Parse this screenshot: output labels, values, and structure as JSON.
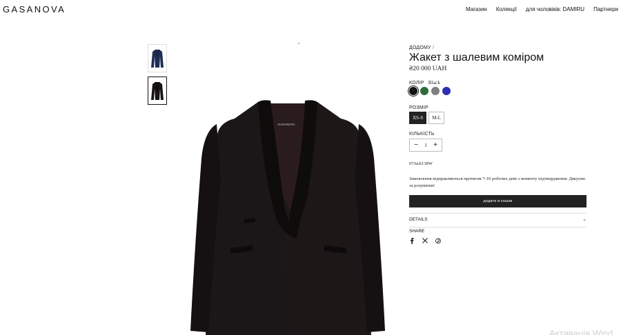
{
  "header": {
    "logo": "GASANOVA",
    "nav": [
      "Магазин",
      "Колекції",
      "для чоловіків: DAMIRU",
      "Партнери"
    ]
  },
  "breadcrumb": {
    "home": "ДОДОМУ",
    "separator": "/"
  },
  "product": {
    "title": "Жакет з шалевим коміром",
    "price": "₴20 000 UAH",
    "color_label": "КОЛІР",
    "color_value": "Black",
    "colors": [
      "#111111",
      "#2e6b3a",
      "#7f7f7f",
      "#2a2fb0"
    ],
    "size_label": "РОЗМІР",
    "sizes": [
      "XS-S",
      "M-L"
    ],
    "selected_size": "XS-S",
    "qty_label": "КІЛЬКІСТЬ",
    "qty_minus": "−",
    "qty_value": "1",
    "qty_plus": "+",
    "sku": "07Jack138W",
    "note": "Замовлення відправляються протягом 7-10 робочих днів з моменту підтвердження. Дякуємо за розуміння!",
    "add_to_cart": "додати в кошик",
    "details": "DETAILS",
    "share": "SHARE",
    "share_icons": [
      "facebook-icon",
      "x-icon",
      "pinterest-icon"
    ]
  },
  "jacket_label": "GASANOVA",
  "watermark": "Активація Wind"
}
